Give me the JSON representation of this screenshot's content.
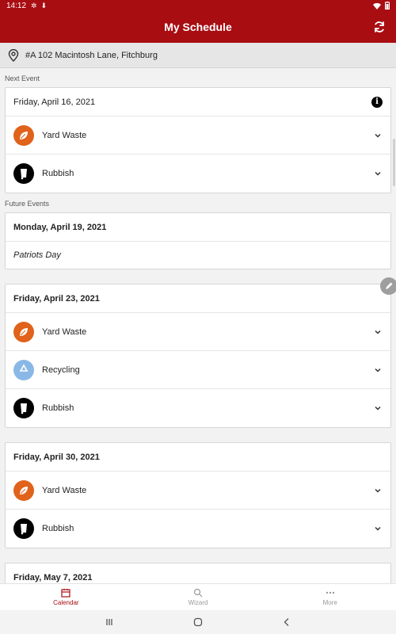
{
  "status_bar": {
    "time": "14:12"
  },
  "app_bar": {
    "title": "My Schedule"
  },
  "address": {
    "text": "#A 102 Macintosh Lane, Fitchburg"
  },
  "next_event": {
    "label": "Next Event",
    "date": "Friday, April 16, 2021",
    "items": [
      {
        "label": "Yard Waste",
        "icon": "leaf-icon",
        "color": "#e0621b"
      },
      {
        "label": "Rubbish",
        "icon": "trash-bin-icon",
        "color": "#000000"
      }
    ]
  },
  "future_label": "Future Events",
  "future_events": [
    {
      "date": "Monday, April 19, 2021",
      "note": "Patriots Day"
    },
    {
      "date": "Friday, April 23, 2021",
      "items": [
        {
          "label": "Yard Waste",
          "icon": "leaf-icon",
          "color": "#e0621b"
        },
        {
          "label": "Recycling",
          "icon": "recycle-icon",
          "color": "#8ab8e6"
        },
        {
          "label": "Rubbish",
          "icon": "trash-bin-icon",
          "color": "#000000"
        }
      ]
    },
    {
      "date": "Friday, April 30, 2021",
      "items": [
        {
          "label": "Yard Waste",
          "icon": "leaf-icon",
          "color": "#e0621b"
        },
        {
          "label": "Rubbish",
          "icon": "trash-bin-icon",
          "color": "#000000"
        }
      ]
    },
    {
      "date": "Friday, May 7, 2021"
    }
  ],
  "bottom_nav": [
    {
      "label": "Calendar",
      "icon": "calendar-icon",
      "active": true
    },
    {
      "label": "Wizard",
      "icon": "wizard-search-icon",
      "active": false
    },
    {
      "label": "More",
      "icon": "more-dots-icon",
      "active": false
    }
  ],
  "colors": {
    "brand": "#a80d12",
    "yard_waste": "#e0621b",
    "recycling": "#8ab8e6",
    "rubbish": "#000000"
  }
}
